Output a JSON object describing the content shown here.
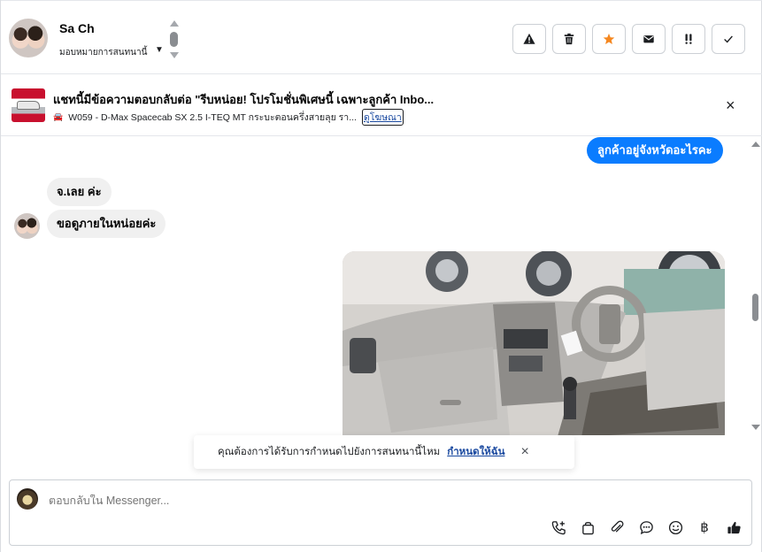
{
  "header": {
    "contact_name": "Sa Ch",
    "assign_label": "มอบหมายการสนทนานี้",
    "actions": [
      {
        "name": "report-spam-button",
        "icon": "warning-icon"
      },
      {
        "name": "delete-button",
        "icon": "trash-icon"
      },
      {
        "name": "star-button",
        "icon": "star-icon"
      },
      {
        "name": "mark-unread-button",
        "icon": "envelope-icon"
      },
      {
        "name": "follow-up-button",
        "icon": "exclamation-icon"
      },
      {
        "name": "mark-done-button",
        "icon": "check-icon"
      }
    ],
    "star_color": "#f5871f"
  },
  "ad_banner": {
    "title": "แชทนี้มีข้อความตอบกลับต่อ \"รีบหน่อย! โปรโมชั่นพิเศษนี้ เฉพาะลูกค้า Inbo...",
    "subtitle": "W059 - D-Max Spacecab SX 2.5 I-TEQ MT กระบะตอนครึ่งสายลุย รา...",
    "link_text": "ดูโฆษณา",
    "close": "×"
  },
  "messages": [
    {
      "direction": "out",
      "text": "ลูกค้าอยู่จังหวัดอะไรคะ"
    },
    {
      "direction": "in",
      "text": "จ.เลย ค่ะ"
    },
    {
      "direction": "in",
      "text": "ขอดูภายในหน่อยค่ะ"
    }
  ],
  "brand_color": "#0a7cff",
  "toast": {
    "text": "คุณต้องการได้รับการกำหนดไปยังการสนทนานี้ไหม",
    "link": "กำหนดให้ฉัน",
    "close": "×"
  },
  "composer": {
    "placeholder": "ตอบกลับใน Messenger...",
    "tools": [
      "call-add-icon",
      "shopping-bag-icon",
      "paperclip-icon",
      "saved-reply-icon",
      "emoji-icon",
      "baht-icon",
      "thumbs-up-icon"
    ],
    "baht_symbol": "฿"
  }
}
